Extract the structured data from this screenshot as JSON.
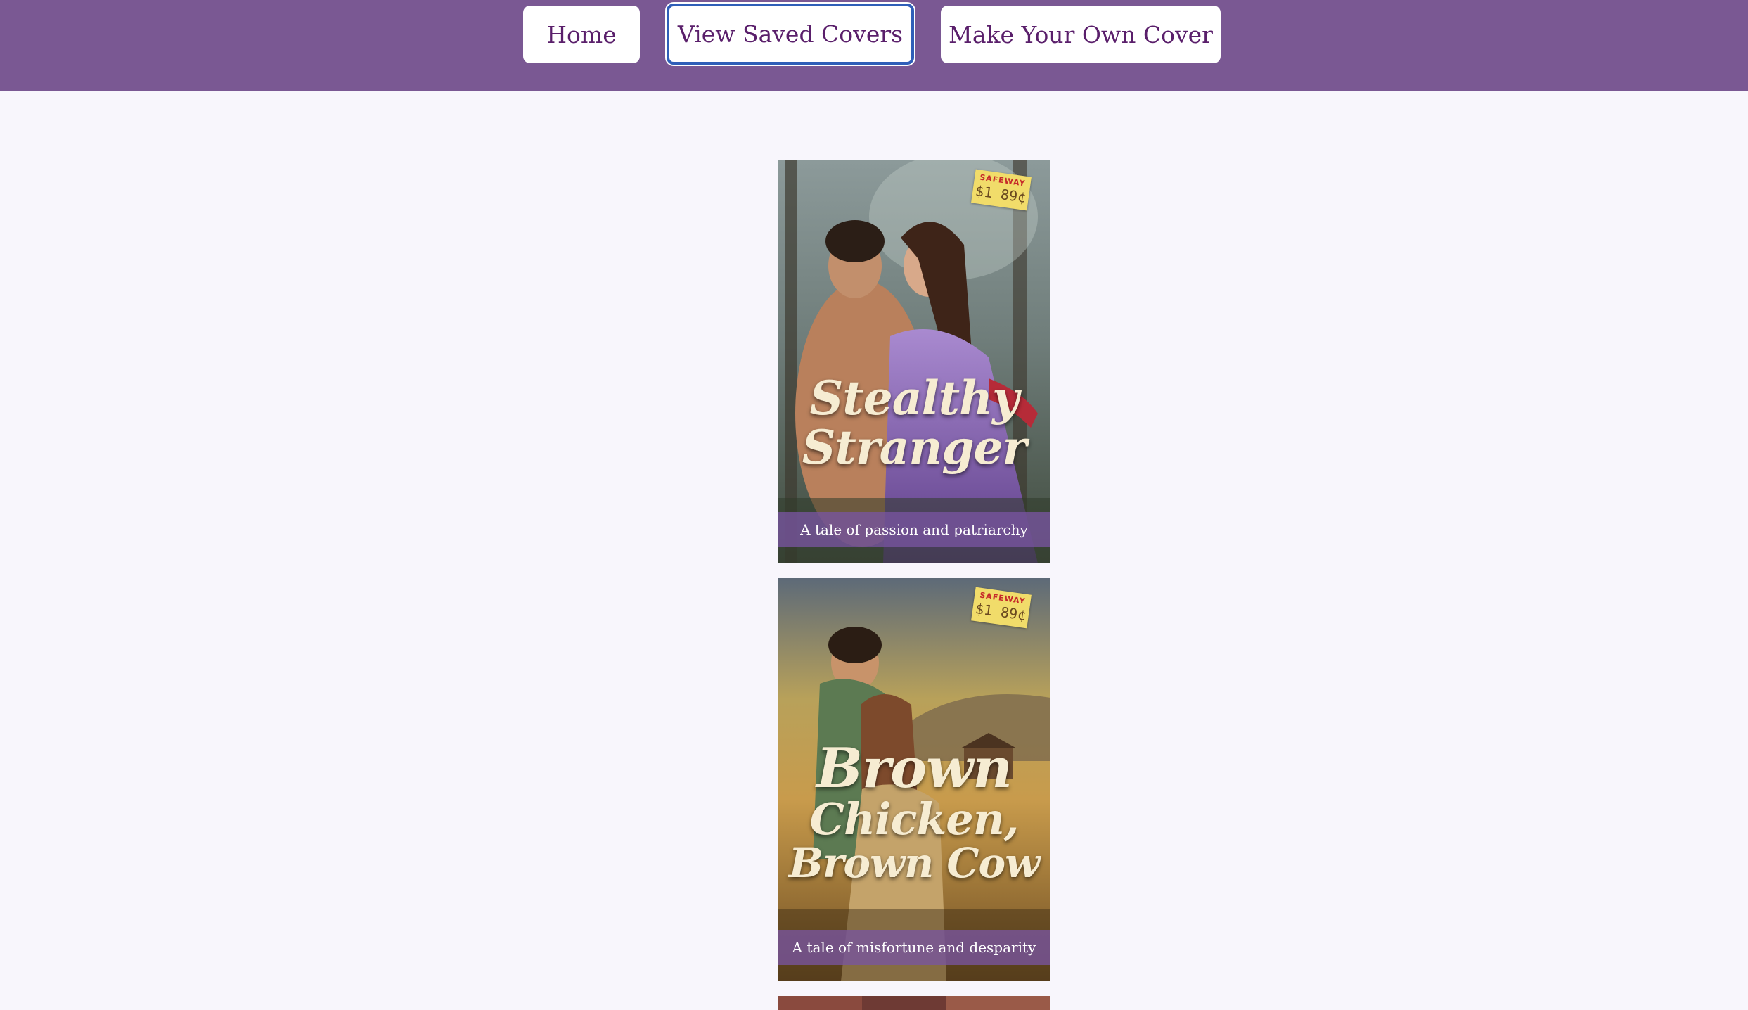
{
  "nav": {
    "home_label": "Home",
    "saved_label": "View Saved Covers",
    "make_label": "Make Your Own Cover"
  },
  "colors": {
    "nav_background": "#7a5893",
    "page_background": "#f8f6fc",
    "button_text": "#5a1f6b",
    "focus_ring": "#2f5fb8"
  },
  "saved_covers": [
    {
      "title_lines": [
        "Stealthy",
        "Stranger"
      ],
      "tagline": "A tale of passion and patriarchy",
      "price_store": "SAFEWAY",
      "price": "$1 89¢"
    },
    {
      "title_lines": [
        "Brown",
        "Chicken,",
        "Brown Cow"
      ],
      "tagline": "A tale of misfortune and desparity",
      "price_store": "SAFEWAY",
      "price": "$1 89¢"
    }
  ]
}
